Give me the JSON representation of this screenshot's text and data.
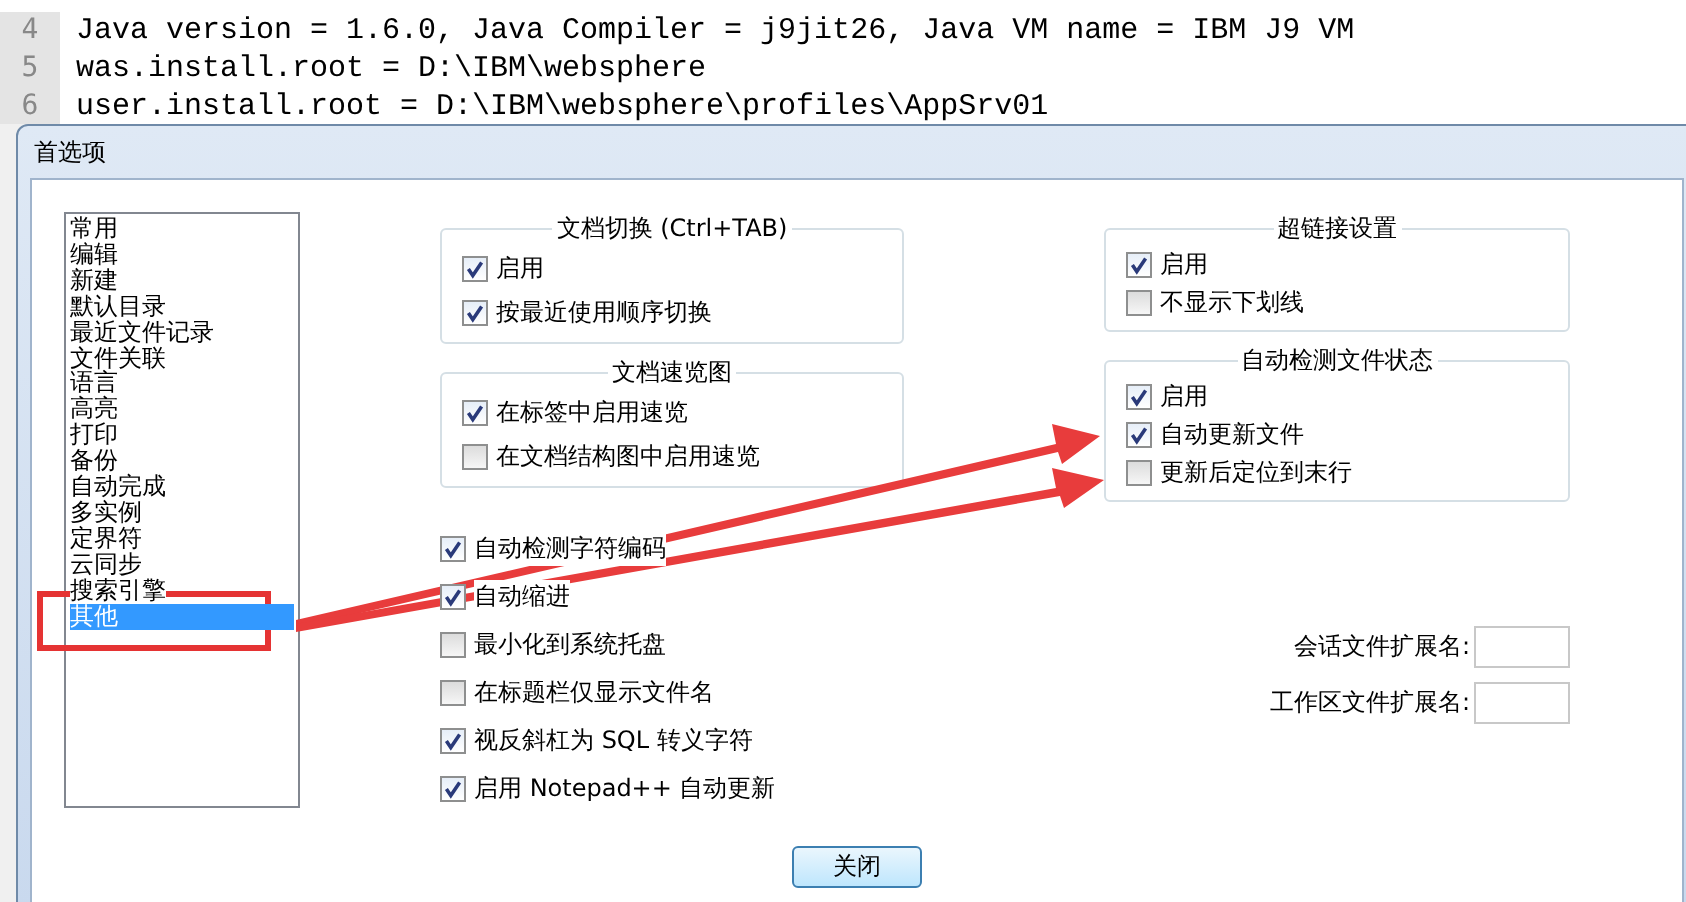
{
  "editor": {
    "lines": [
      {
        "number": "4",
        "text": "Java version = 1.6.0, Java Compiler = j9jit26, Java VM name = IBM J9 VM"
      },
      {
        "number": "5",
        "text": "was.install.root = D:\\IBM\\websphere"
      },
      {
        "number": "6",
        "text": "user.install.root = D:\\IBM\\websphere\\profiles\\AppSrv01"
      }
    ]
  },
  "dialog": {
    "title": "首选项",
    "categories": [
      {
        "label": "常用",
        "selected": false
      },
      {
        "label": "编辑",
        "selected": false
      },
      {
        "label": "新建",
        "selected": false
      },
      {
        "label": "默认目录",
        "selected": false
      },
      {
        "label": "最近文件记录",
        "selected": false
      },
      {
        "label": "文件关联",
        "selected": false
      },
      {
        "label": "语言",
        "selected": false
      },
      {
        "label": "高亮",
        "selected": false
      },
      {
        "label": "打印",
        "selected": false
      },
      {
        "label": "备份",
        "selected": false
      },
      {
        "label": "自动完成",
        "selected": false
      },
      {
        "label": "多实例",
        "selected": false
      },
      {
        "label": "定界符",
        "selected": false
      },
      {
        "label": "云同步",
        "selected": false
      },
      {
        "label": "搜索引擎",
        "selected": false
      },
      {
        "label": "其他",
        "selected": true
      }
    ],
    "left_groups": [
      {
        "title": "文档切换 (Ctrl+TAB)",
        "options": [
          {
            "label": "启用",
            "checked": true
          },
          {
            "label": "按最近使用顺序切换",
            "checked": true
          }
        ]
      },
      {
        "title": "文档速览图",
        "options": [
          {
            "label": "在标签中启用速览",
            "checked": true
          },
          {
            "label": "在文档结构图中启用速览",
            "checked": false
          }
        ]
      }
    ],
    "right_groups": [
      {
        "title": "超链接设置",
        "options": [
          {
            "label": "启用",
            "checked": true
          },
          {
            "label": "不显示下划线",
            "checked": false
          }
        ]
      },
      {
        "title": "自动检测文件状态",
        "options": [
          {
            "label": "启用",
            "checked": true
          },
          {
            "label": "自动更新文件",
            "checked": true
          },
          {
            "label": "更新后定位到末行",
            "checked": false
          }
        ]
      }
    ],
    "options": [
      {
        "label": "自动检测字符编码",
        "checked": true
      },
      {
        "label": "自动缩进",
        "checked": true
      },
      {
        "label": "最小化到系统托盘",
        "checked": false
      },
      {
        "label": "在标题栏仅显示文件名",
        "checked": false
      },
      {
        "label": "视反斜杠为 SQL 转义字符",
        "checked": true
      },
      {
        "label": "启用 Notepad++ 自动更新",
        "checked": true
      }
    ],
    "fields": [
      {
        "label": "会话文件扩展名:"
      },
      {
        "label": "工作区文件扩展名:"
      }
    ],
    "close_button": "关闭"
  }
}
